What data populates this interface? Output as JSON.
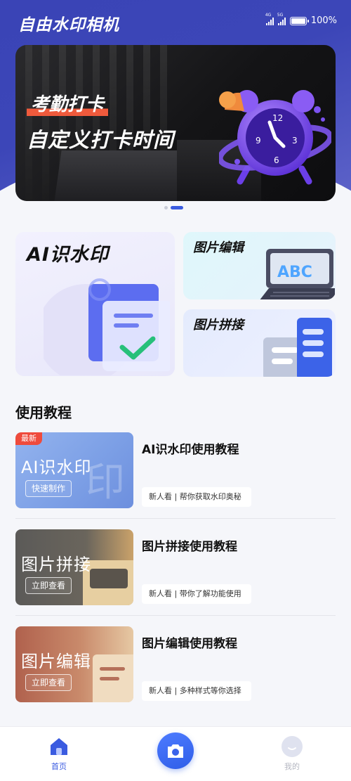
{
  "app": {
    "title": "自由水印相机"
  },
  "status_bar": {
    "signal1": "4G",
    "signal2": "5G",
    "battery": "100%"
  },
  "banner": {
    "title": "考勤打卡",
    "subtitle": "自定义打卡时间",
    "page_count": 2,
    "active_index": 1
  },
  "features": {
    "ai": {
      "label": "AI识水印"
    },
    "edit": {
      "label": "图片编辑",
      "art_text": "ABC"
    },
    "stitch": {
      "label": "图片拼接"
    }
  },
  "tutorials": {
    "heading": "使用教程",
    "items": [
      {
        "title": "AI识水印使用教程",
        "tag": "新人看 | 帮你获取水印奥秘",
        "thumb_text": "AI识水印",
        "thumb_button": "快速制作",
        "badge": "最新"
      },
      {
        "title": "图片拼接使用教程",
        "tag": "新人看 | 带你了解功能使用",
        "thumb_text": "图片拼接",
        "thumb_button": "立即查看"
      },
      {
        "title": "图片编辑使用教程",
        "tag": "新人看 | 多种样式等你选择",
        "thumb_text": "图片编辑",
        "thumb_button": "立即查看"
      }
    ]
  },
  "nav": {
    "home": "首页",
    "camera": "camera-icon",
    "mine": "我的"
  },
  "colors": {
    "primary": "#3a5be0",
    "header": "#3c46b8",
    "badge": "#ef4b3c"
  }
}
